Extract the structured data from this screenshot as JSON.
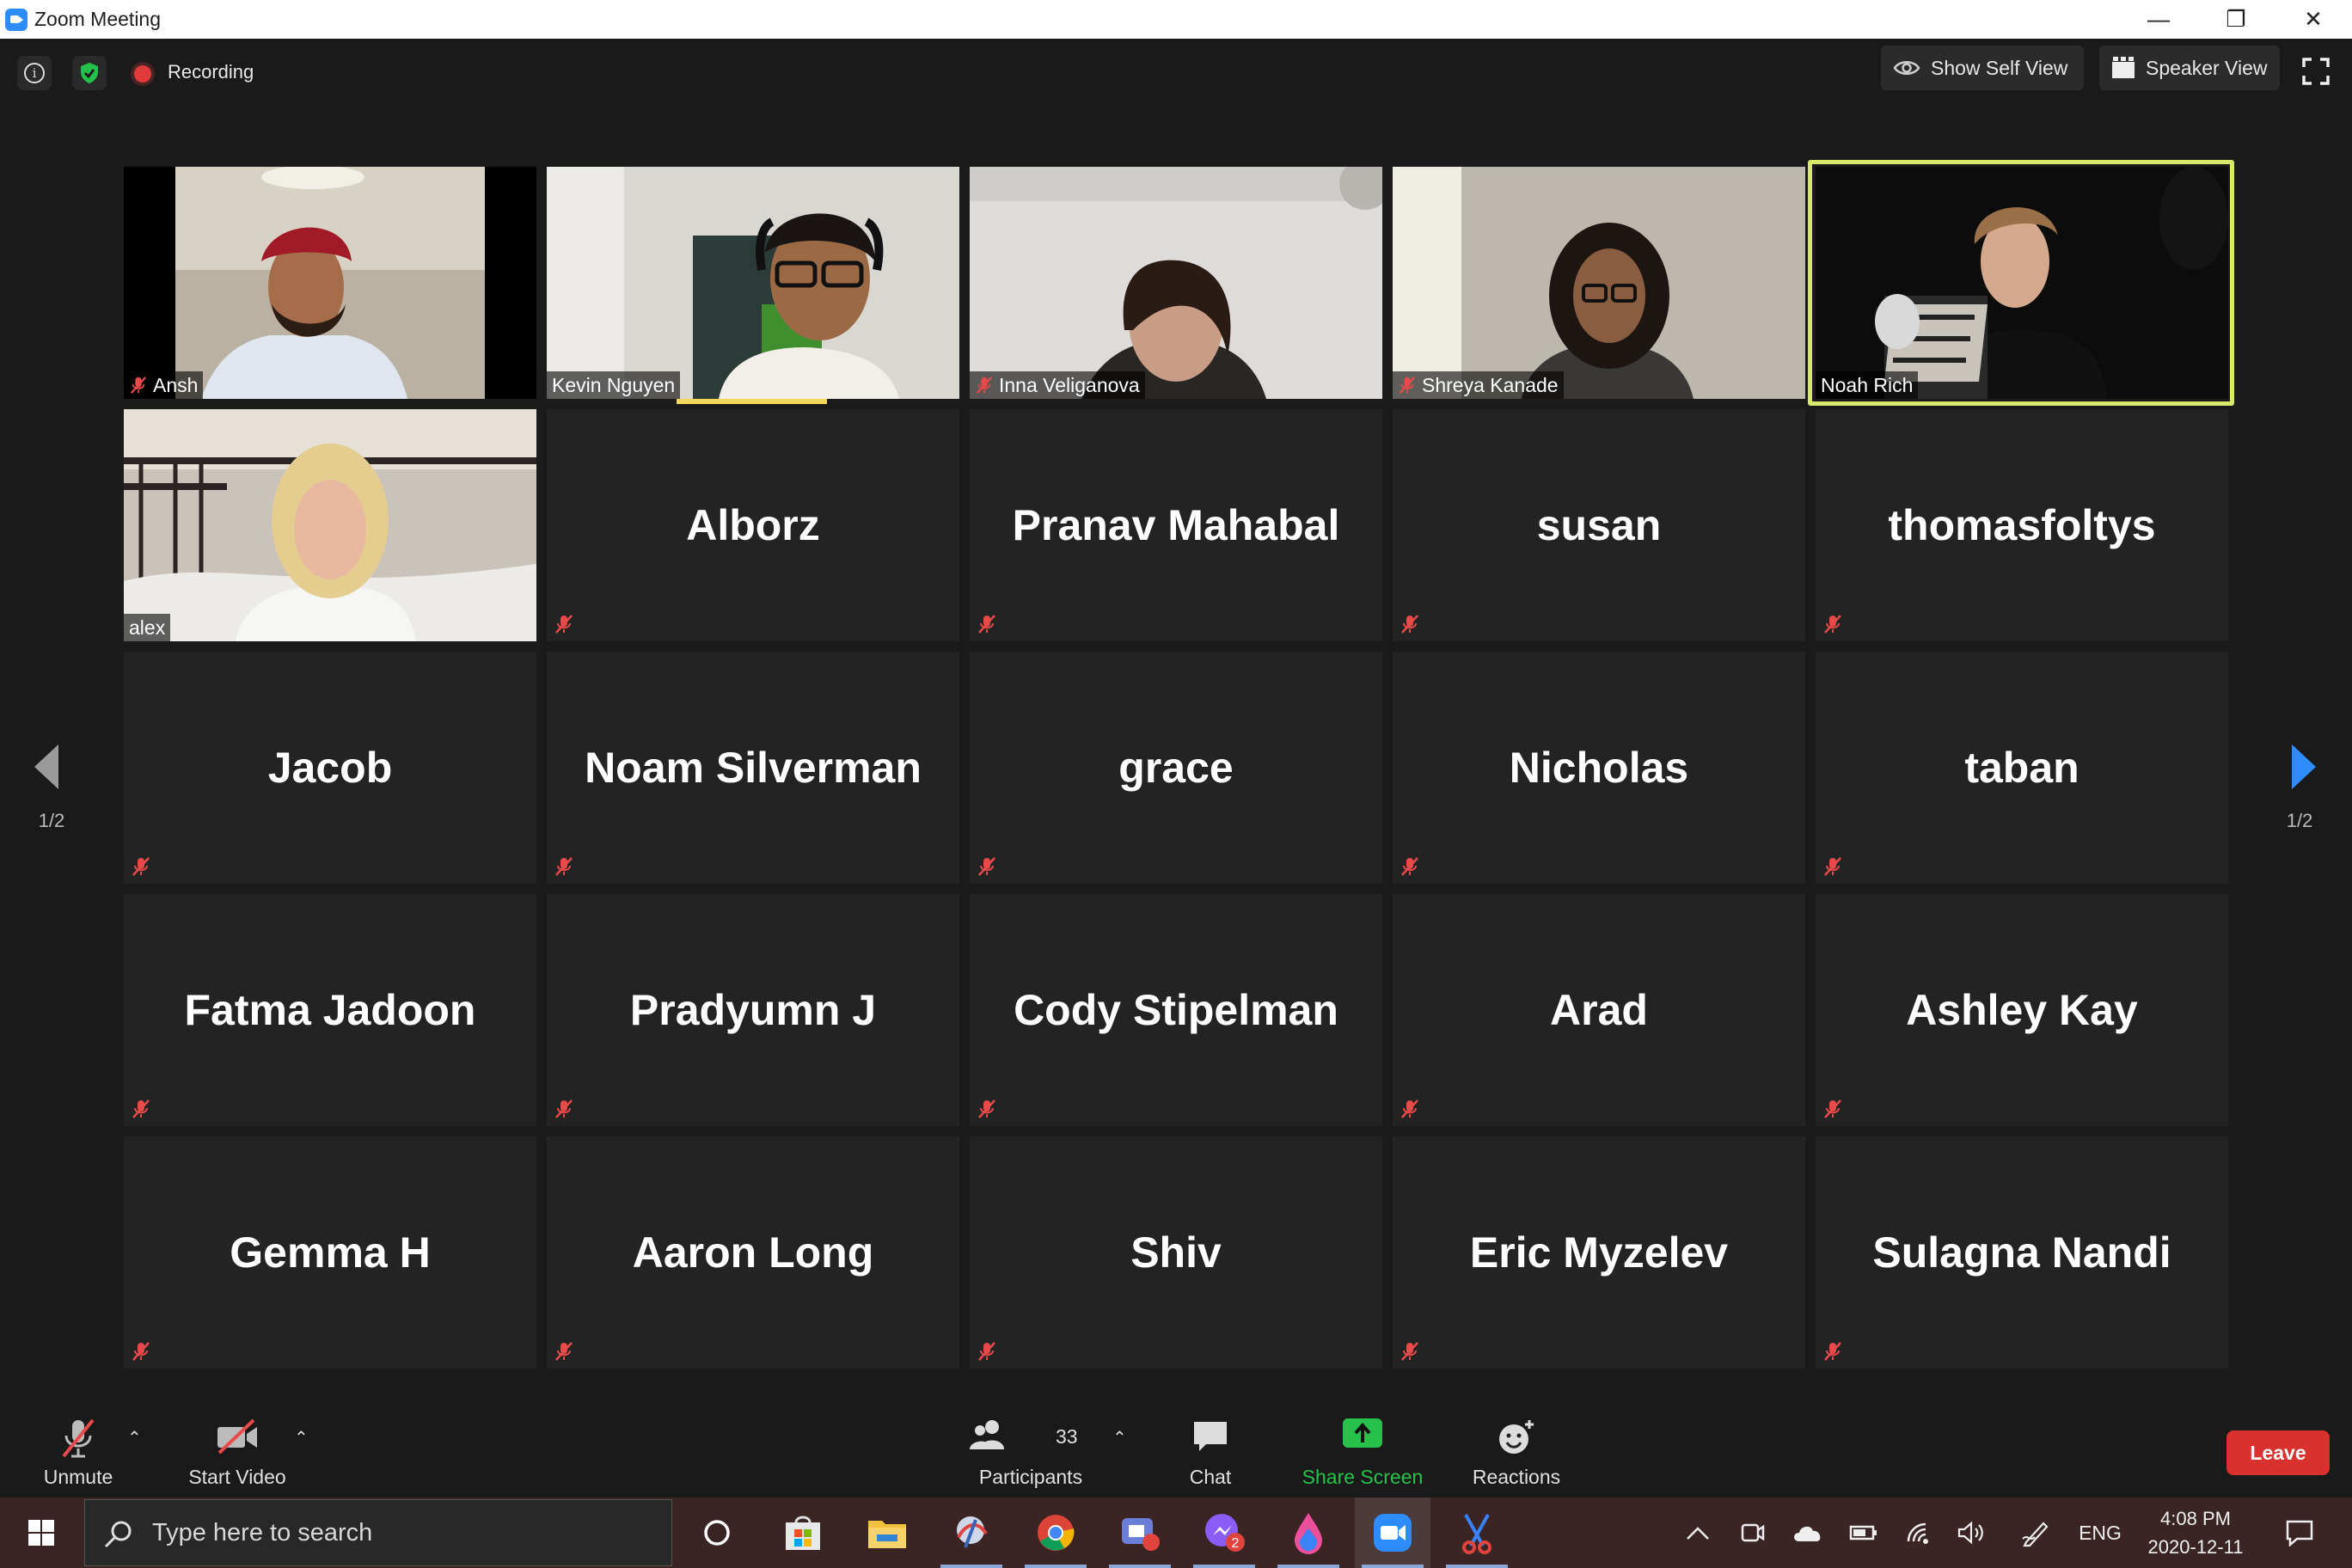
{
  "window": {
    "title": "Zoom Meeting",
    "controls": [
      "—",
      "❐",
      "✕"
    ]
  },
  "topbar": {
    "recording_label": "Recording",
    "show_self_view": "Show Self View",
    "speaker_view": "Speaker View"
  },
  "pagination": {
    "left_label": "1/2",
    "right_label": "1/2"
  },
  "video_tiles": [
    {
      "name": "Ansh"
    },
    {
      "name": "Kevin Nguyen"
    },
    {
      "name": "Inna Veliganova"
    },
    {
      "name": "Shreya Kanade"
    },
    {
      "name": "Noah Rich"
    },
    {
      "name": "alex"
    }
  ],
  "name_tiles": [
    "Alborz",
    "Pranav Mahabal",
    "susan",
    "thomasfoltys",
    "Jacob",
    "Noam Silverman",
    "grace",
    "Nicholas",
    "taban",
    "Fatma Jadoon",
    "Pradyumn J",
    "Cody Stipelman",
    "Arad",
    "Ashley Kay",
    "Gemma H",
    "Aaron Long",
    "Shiv",
    "Eric Myzelev",
    "Sulagna Nandi"
  ],
  "toolbar": {
    "unmute": "Unmute",
    "start_video": "Start Video",
    "participants": "Participants",
    "participant_count": "33",
    "chat": "Chat",
    "share_screen": "Share Screen",
    "reactions": "Reactions",
    "leave": "Leave"
  },
  "taskbar": {
    "search_placeholder": "Type here to search",
    "language": "ENG",
    "time": "4:08 PM",
    "date": "2020-12-11",
    "messenger_badge": "2"
  },
  "colors": {
    "speaker_highlight": "#d8e86a",
    "share_screen_green": "#27c24c",
    "leave_red": "#d9322e",
    "next_arrow_blue": "#2d8cff"
  }
}
